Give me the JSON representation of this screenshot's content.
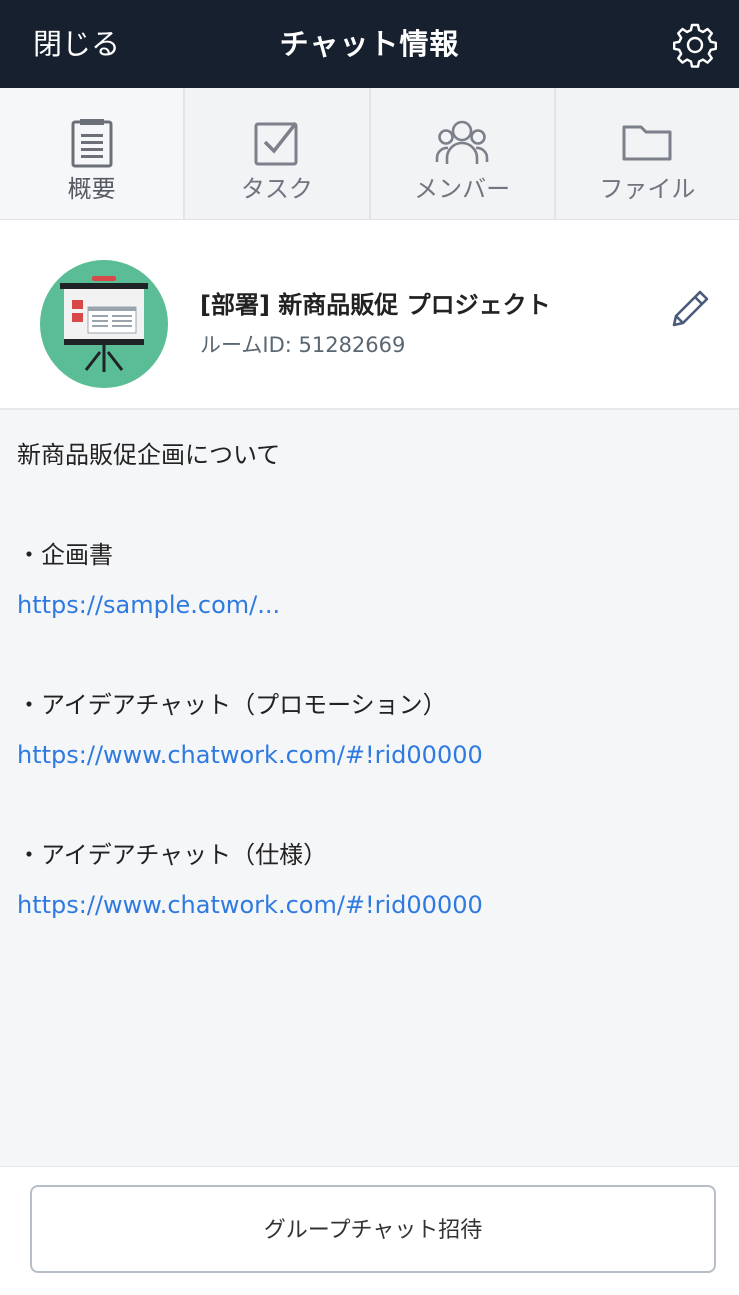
{
  "header": {
    "close_label": "閉じる",
    "title": "チャット情報",
    "settings_icon": "gear-icon"
  },
  "tabs": [
    {
      "label": "概要",
      "icon": "clipboard-icon"
    },
    {
      "label": "タスク",
      "icon": "checkbox-icon"
    },
    {
      "label": "メンバー",
      "icon": "members-icon"
    },
    {
      "label": "ファイル",
      "icon": "folder-icon"
    }
  ],
  "room": {
    "name": "[部署] 新商品販促 プロジェクト",
    "id_text": "ルームID: 51282669",
    "edit_icon": "pencil-icon"
  },
  "description": {
    "line1": "新商品販促企画について",
    "item1_title": "・企画書",
    "item1_link": "https://sample.com/...",
    "item2_title": "・アイデアチャット（プロモーション）",
    "item2_link": "https://www.chatwork.com/#!rid00000",
    "item3_title": "・アイデアチャット（仕様）",
    "item3_link": "https://www.chatwork.com/#!rid00000"
  },
  "footer": {
    "invite_label": "グループチャット招待"
  },
  "colors": {
    "header_bg": "#17202e",
    "link": "#2f7ae0",
    "avatar_bg": "#5bbd96"
  }
}
